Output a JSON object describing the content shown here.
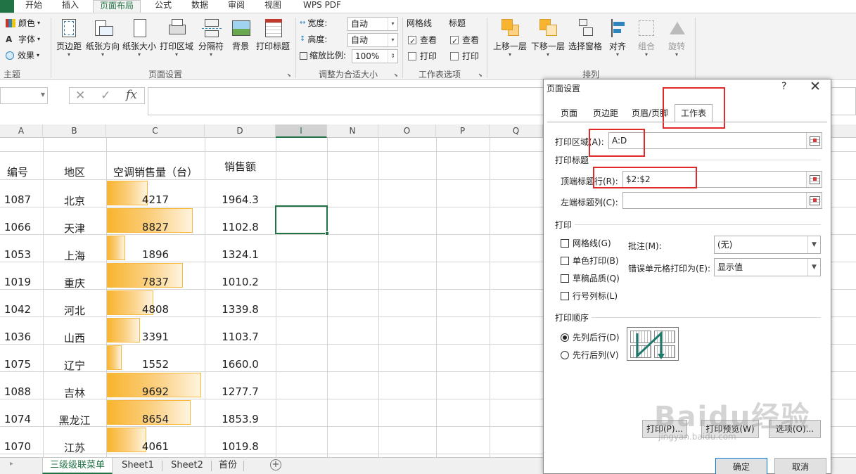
{
  "ribbon_tabs": [
    "开始",
    "插入",
    "页面布局",
    "公式",
    "数据",
    "审阅",
    "视图",
    "WPS PDF"
  ],
  "ribbon": {
    "theme_group": {
      "colors": "颜色",
      "fonts": "字体",
      "effects": "效果",
      "label": "主题"
    },
    "page_setup_group": {
      "buttons": [
        "页边距",
        "纸张方向",
        "纸张大小",
        "打印区域",
        "分隔符",
        "背景",
        "打印标题"
      ],
      "label": "页面设置"
    },
    "scale_group": {
      "width_label": "宽度:",
      "width_value": "自动",
      "height_label": "高度:",
      "height_value": "自动",
      "scale_label": "缩放比例:",
      "scale_value": "100%",
      "label": "调整为合适大小"
    },
    "sheet_options_group": {
      "gridlines": "网格线",
      "headings": "标题",
      "view": "查看",
      "print": "打印",
      "label": "工作表选项"
    },
    "arrange_group": {
      "buttons": [
        "上移一层",
        "下移一层",
        "选择窗格",
        "对齐",
        "组合",
        "旋转"
      ],
      "label": "排列"
    }
  },
  "formula_bar": {
    "fx": "fx",
    "cancel": "✕",
    "enter": "✓"
  },
  "columns": [
    "A",
    "B",
    "C",
    "D",
    "I",
    "N",
    "O",
    "P",
    "Q"
  ],
  "table": {
    "headers": [
      "编号",
      "地区",
      "空调销售量（台）",
      "销售额"
    ],
    "rows": [
      {
        "id": "1087",
        "region": "北京",
        "qty": 4217,
        "sales": "1964.3"
      },
      {
        "id": "1066",
        "region": "天津",
        "qty": 8827,
        "sales": "1102.8"
      },
      {
        "id": "1053",
        "region": "上海",
        "qty": 1896,
        "sales": "1324.1"
      },
      {
        "id": "1019",
        "region": "重庆",
        "qty": 7837,
        "sales": "1010.2"
      },
      {
        "id": "1042",
        "region": "河北",
        "qty": 4808,
        "sales": "1339.8"
      },
      {
        "id": "1036",
        "region": "山西",
        "qty": 3391,
        "sales": "1103.7"
      },
      {
        "id": "1075",
        "region": "辽宁",
        "qty": 1552,
        "sales": "1660.0"
      },
      {
        "id": "1088",
        "region": "吉林",
        "qty": 9692,
        "sales": "1277.7"
      },
      {
        "id": "1074",
        "region": "黑龙江",
        "qty": 8654,
        "sales": "1853.9"
      },
      {
        "id": "1070",
        "region": "江苏",
        "qty": 4061,
        "sales": "1019.8"
      }
    ]
  },
  "sheet_tabs": [
    "三级级联菜单",
    "Sheet1",
    "Sheet2",
    "首份"
  ],
  "dialog": {
    "title": "页面设置",
    "help": "?",
    "close": "✕",
    "tabs": [
      "页面",
      "页边距",
      "页眉/页脚",
      "工作表"
    ],
    "print_area_label": "打印区域(A):",
    "print_area_value": "A:D",
    "print_titles_label": "打印标题",
    "top_rows_label": "顶端标题行(R):",
    "top_rows_value": "$2:$2",
    "left_cols_label": "左端标题列(C):",
    "left_cols_value": "",
    "print_label": "打印",
    "checkboxes": [
      "网格线(G)",
      "单色打印(B)",
      "草稿品质(Q)",
      "行号列标(L)"
    ],
    "comments_label": "批注(M):",
    "comments_value": "(无)",
    "errors_label": "错误单元格打印为(E):",
    "errors_value": "显示值",
    "order_label": "打印顺序",
    "order_options": [
      "先列后行(D)",
      "先行后列(V)"
    ],
    "buttons": {
      "print": "打印(P)...",
      "preview": "打印预览(W)",
      "options": "选项(O)...",
      "ok": "确定",
      "cancel": "取消"
    }
  },
  "watermark": {
    "brand": "Baidu经验",
    "url": "jingyan.baidu.com"
  },
  "colors": {
    "excel_green": "#217346",
    "bar_orange": "#f8b42e",
    "highlight_red": "#e02a2a"
  }
}
